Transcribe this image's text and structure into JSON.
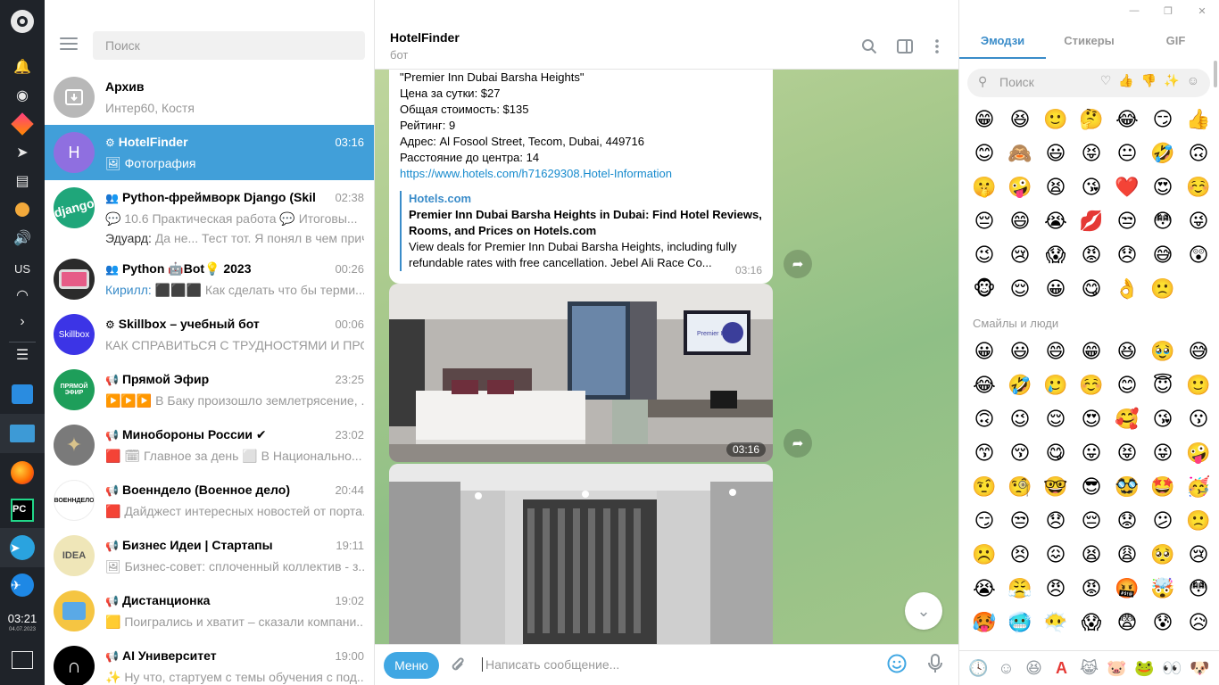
{
  "dock": {
    "lang": "US",
    "time": "03:21",
    "date": "04.07.2023"
  },
  "chatlist": {
    "search_placeholder": "Поиск",
    "rows": [
      {
        "title": "Архив",
        "sub": "Интер60, Костя",
        "time": ""
      },
      {
        "title": "HotelFinder",
        "sub": "🖼 Фотография",
        "time": "03:16"
      },
      {
        "title": "Python-фреймворк Django (Skillb...",
        "sub": "💬 10.6 Практическая работа 💬 Итоговы...",
        "sub2_name": "Эдуард:",
        "sub2": "Да не... Тест тот. Я понял в чем прич...",
        "time": "02:38"
      },
      {
        "title": "Python 🤖Bot💡 2023",
        "sub_name": "Кирилл:",
        "sub": "⬛⬛⬛ Как сделать что бы терми...",
        "time": "00:26"
      },
      {
        "title": "Skillbox – учебный бот",
        "sub": "КАК СПРАВИТЬСЯ С ТРУДНОСТЯМИ И ПРОЙ...",
        "time": "00:06"
      },
      {
        "title": "Прямой Эфир",
        "sub": "▶️▶️▶️ В Баку произошло землетрясение, ...",
        "time": "23:25"
      },
      {
        "title": "Минобороны России ✔",
        "sub": "🟥 🗓 Главное за день ⬜ В Национально...",
        "time": "23:02"
      },
      {
        "title": "Военндело (Военное дело)",
        "sub": "🟥 Дайджест интересных новостей от порта...",
        "time": "20:44"
      },
      {
        "title": "Бизнес Идеи | Стартапы",
        "sub": "🖼 Бизнес-совет: сплоченный коллектив - з...",
        "time": "19:11"
      },
      {
        "title": "Дистанционка",
        "sub": "🟨 Поигрались и хватит – сказали компани...",
        "time": "19:02"
      },
      {
        "title": "AI Университет",
        "sub": "✨ Ну что, стартуем с темы обучения с под...",
        "time": "19:00"
      }
    ],
    "avatar_letter": "H",
    "skillbox_avatar": "Skillbox",
    "django_avatar": "django",
    "voen_avatar": "ВОЕННДЕЛО",
    "idea_avatar": "IDEA",
    "efir_avatar": "ПРЯМОЙ ЭФИР"
  },
  "chat": {
    "name": "HotelFinder",
    "status": "бот",
    "message": {
      "lines": [
        "\"Premier Inn Dubai Barsha Heights\"",
        "Цена за сутки: $27",
        "Общая стоимость: $135",
        "Рейтинг: 9",
        "Адрес: Al Fosool Street, Tecom, Dubai, 449716",
        "Расстояние до центра: 14"
      ],
      "link": "https://www.hotels.com/h71629308.Hotel-Information",
      "preview_site": "Hotels.com",
      "preview_title": "Premier Inn Dubai Barsha Heights in Dubai: Find Hotel Reviews, Rooms, and Prices on Hotels.com",
      "preview_desc": "View deals for Premier Inn Dubai Barsha Heights, including fully refundable rates with free cancellation. Jebel Ali Race Co...",
      "time": "03:16"
    },
    "photo1_time": "03:16",
    "tv_sign": "Premier Inn",
    "menu_label": "Меню",
    "input_placeholder": "Написать сообщение..."
  },
  "emoji_panel": {
    "tabs": [
      "Эмодзи",
      "Стикеры",
      "GIF"
    ],
    "search_placeholder": "Поиск",
    "recent": [
      "😁",
      "😆",
      "🙂",
      "🤔",
      "😂",
      "😏",
      "👍",
      "😊",
      "🙈",
      "😃",
      "😝",
      "😐",
      "🤣",
      "🙃",
      "🤫",
      "🤪",
      "😫",
      "😘",
      "❤️",
      "😍",
      "☺️",
      "😔",
      "😄",
      "😭",
      "💋",
      "😒",
      "😳",
      "😜",
      "😉",
      "😢",
      "😱",
      "😡",
      "😞",
      "😅",
      "😲",
      "🐵",
      "😌",
      "😀",
      "😋",
      "👌",
      "🙁"
    ],
    "section_title": "Смайлы и люди",
    "people": [
      "😀",
      "😃",
      "😄",
      "😁",
      "😆",
      "🥹",
      "😅",
      "😂",
      "🤣",
      "🥲",
      "☺️",
      "😊",
      "😇",
      "🙂",
      "🙃",
      "😉",
      "😌",
      "😍",
      "🥰",
      "😘",
      "😗",
      "😙",
      "😚",
      "😋",
      "😛",
      "😝",
      "😜",
      "🤪",
      "🤨",
      "🧐",
      "🤓",
      "😎",
      "🥸",
      "🤩",
      "🥳",
      "😏",
      "😒",
      "😞",
      "😔",
      "😟",
      "😕",
      "🙁",
      "☹️",
      "😣",
      "😖",
      "😫",
      "😩",
      "🥺",
      "😢",
      "😭",
      "😤",
      "😠",
      "😡",
      "🤬",
      "🤯",
      "😳",
      "🥵",
      "🥶",
      "😶‍🌫️",
      "😱",
      "😨",
      "😰",
      "😥"
    ]
  }
}
